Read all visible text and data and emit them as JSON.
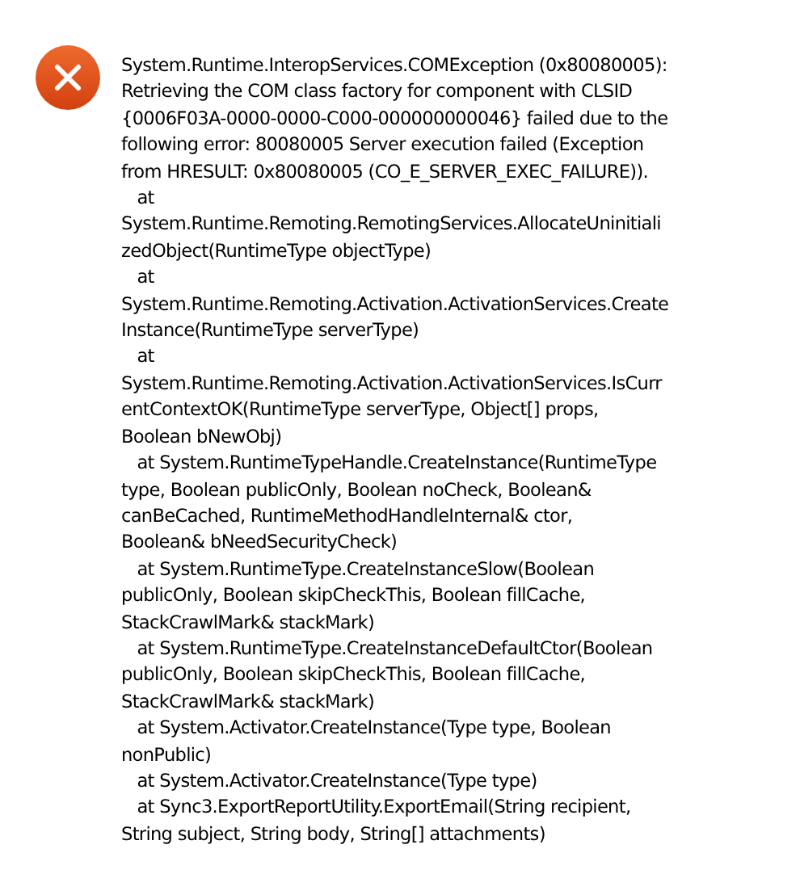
{
  "dialog": {
    "kind": "error",
    "message": "System.Runtime.InteropServices.COMException (0x80080005):\nRetrieving the COM class factory for component with CLSID\n{0006F03A-0000-0000-C000-000000000046} failed due to the\nfollowing error: 80080005 Server execution failed (Exception\nfrom HRESULT: 0x80080005 (CO_E_SERVER_EXEC_FAILURE)).\n   at\nSystem.Runtime.Remoting.RemotingServices.AllocateUninitiali\nzedObject(RuntimeType objectType)\n   at\nSystem.Runtime.Remoting.Activation.ActivationServices.Create\nInstance(RuntimeType serverType)\n   at\nSystem.Runtime.Remoting.Activation.ActivationServices.IsCurr\nentContextOK(RuntimeType serverType, Object[] props,\nBoolean bNewObj)\n   at System.RuntimeTypeHandle.CreateInstance(RuntimeType\ntype, Boolean publicOnly, Boolean noCheck, Boolean&\ncanBeCached, RuntimeMethodHandleInternal& ctor,\nBoolean& bNeedSecurityCheck)\n   at System.RuntimeType.CreateInstanceSlow(Boolean\npublicOnly, Boolean skipCheckThis, Boolean fillCache,\nStackCrawlMark& stackMark)\n   at System.RuntimeType.CreateInstanceDefaultCtor(Boolean\npublicOnly, Boolean skipCheckThis, Boolean fillCache,\nStackCrawlMark& stackMark)\n   at System.Activator.CreateInstance(Type type, Boolean\nnonPublic)\n   at System.Activator.CreateInstance(Type type)\n   at Sync3.ExportReportUtility.ExportEmail(String recipient,\nString subject, String body, String[] attachments)"
  }
}
